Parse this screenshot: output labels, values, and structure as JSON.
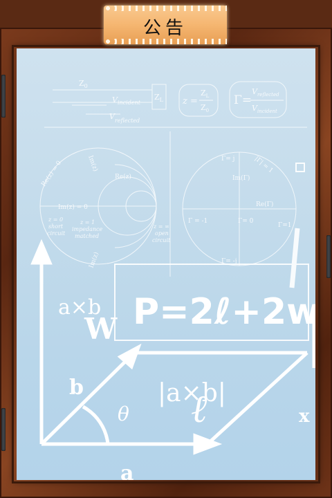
{
  "header": {
    "title": "公告"
  },
  "board": {
    "line_z0": "Z",
    "line_z0_sub": "0",
    "v_incident": "V",
    "v_incident_sub": "incident",
    "v_reflected": "V",
    "v_reflected_sub": "reflected",
    "zl": "Z",
    "zl_sub": "L",
    "formula_z": "z =",
    "formula_zl": "Z",
    "formula_zl_sub": "L",
    "formula_z0": "Z",
    "formula_z0_sub": "0",
    "formula_gamma": "Γ=",
    "formula_vref": "V",
    "formula_vref_sub": "reflected",
    "formula_vinc": "V",
    "formula_vinc_sub": "incident",
    "smith_re0": "Re(z) = 0",
    "smith_im0": "Im(z) = 0",
    "smith_rez": "Re(z)",
    "smith_imz": "Im(z)",
    "smith_imz2": "Im(z)",
    "smith_z0_short": "z = 0",
    "smith_short": "short",
    "smith_circuit": "circuit",
    "smith_z1": "z = 1",
    "smith_impedance": "impedance",
    "smith_matched": "matched",
    "smith_zinf": "z = ∞",
    "smith_open": "open",
    "smith_open_circuit": "circuit",
    "gamma_j": "Γ= j",
    "gamma_abs": "|Γ| = 1",
    "gamma_im": "Im(Γ)",
    "gamma_re": "Re(Γ)",
    "gamma_m1": "Γ = -1",
    "gamma_0": "Γ= 0",
    "gamma_1": "Γ=1",
    "gamma_mj": "Γ= -j",
    "axb": "a×b",
    "w": "W",
    "perimeter": "P=2ℓ+2w",
    "b": "b",
    "theta": "θ",
    "abs_axb": "|a×b|",
    "ell": "ℓ",
    "a": "a",
    "x": "x"
  }
}
